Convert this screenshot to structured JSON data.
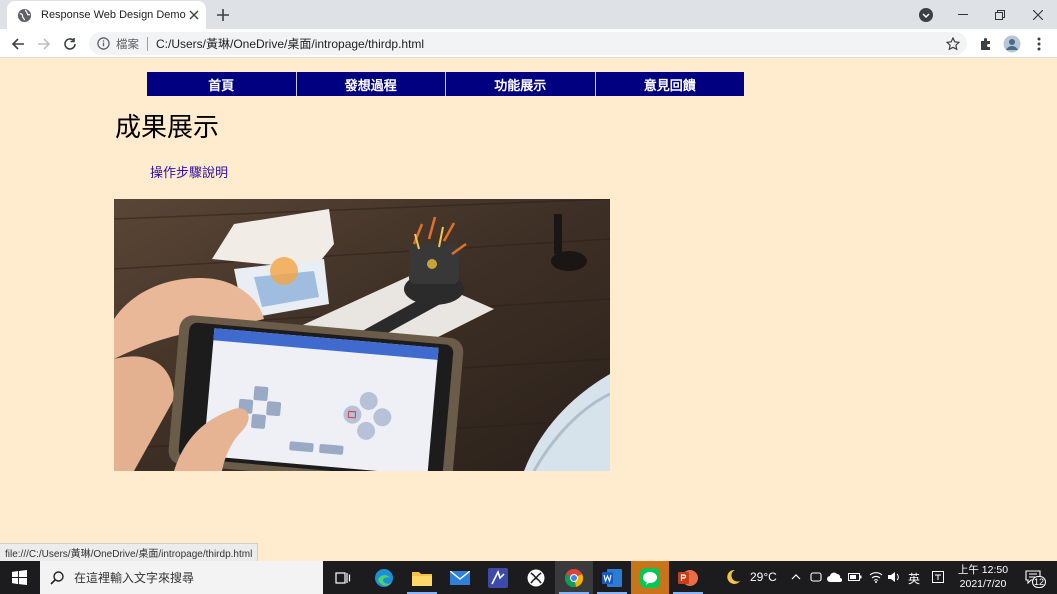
{
  "browser": {
    "tab_title": "Response Web Design Demo",
    "secure_label": "檔案",
    "url": "C:/Users/黃琳/OneDrive/桌面/intropage/thirdp.html",
    "status_url": "file:///C:/Users/黃琳/OneDrive/桌面/intropage/thirdp.html"
  },
  "page": {
    "nav": [
      "首頁",
      "發想過程",
      "功能展示",
      "意見回饋"
    ],
    "title": "成果展示",
    "steps_link": "操作步驟說明"
  },
  "taskbar": {
    "search_placeholder": "在這裡輸入文字來搜尋",
    "temperature": "29°C",
    "ime": "英",
    "time": "上午 12:50",
    "date": "2021/7/20",
    "notification_count": "12"
  },
  "colors": {
    "page_background": "#ffebcd",
    "nav_background": "#000080",
    "link": "#2d10a8"
  }
}
